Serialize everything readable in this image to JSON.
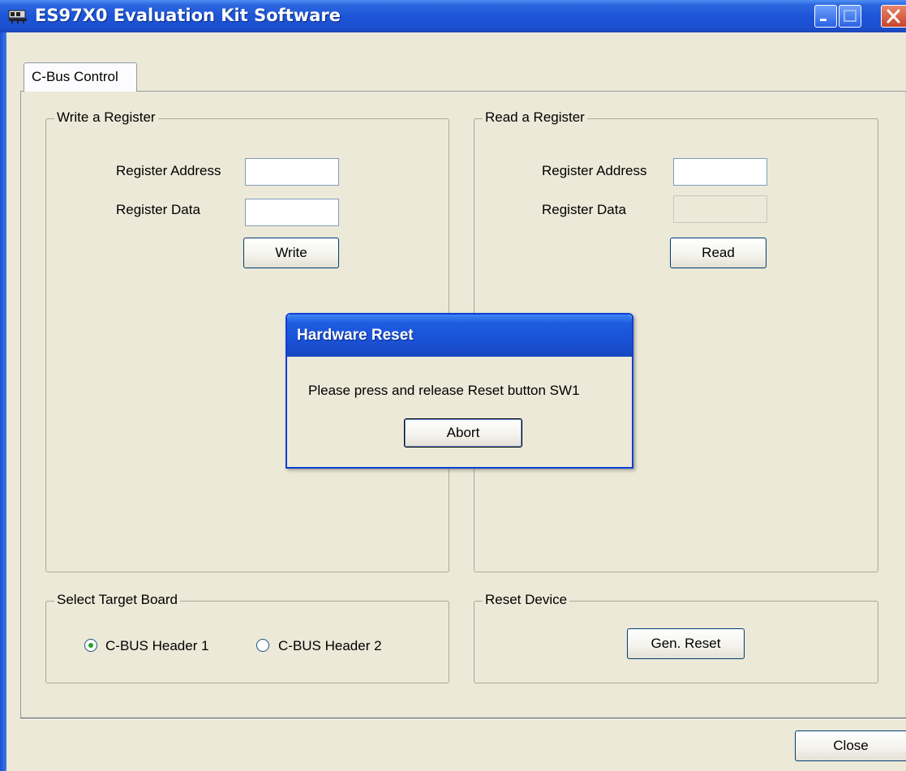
{
  "window": {
    "title": "ES97X0 Evaluation Kit Software"
  },
  "tabs": [
    {
      "label": "C-Bus Control",
      "active": true
    }
  ],
  "write_group": {
    "title": "Write a Register",
    "address_label": "Register Address",
    "address_value": "",
    "data_label": "Register Data",
    "data_value": "",
    "button": "Write"
  },
  "read_group": {
    "title": "Read a Register",
    "address_label": "Register Address",
    "address_value": "",
    "data_label": "Register Data",
    "data_value": "",
    "button": "Read"
  },
  "target_group": {
    "title": "Select Target Board",
    "options": [
      {
        "label": "C-BUS Header 1",
        "selected": true
      },
      {
        "label": "C-BUS Header 2",
        "selected": false
      }
    ]
  },
  "reset_group": {
    "title": "Reset Device",
    "button": "Gen. Reset"
  },
  "footer": {
    "close_button": "Close"
  },
  "dialog": {
    "title": "Hardware Reset",
    "message": "Please press and release Reset button SW1",
    "button": "Abort"
  },
  "colors": {
    "titlebar": "#1d55d8",
    "window_face": "#ece9d8",
    "radio_dot": "#21a121"
  },
  "icons": {
    "app": "app-icon",
    "minimize": "minimize-icon",
    "maximize": "maximize-icon",
    "close": "close-icon"
  }
}
